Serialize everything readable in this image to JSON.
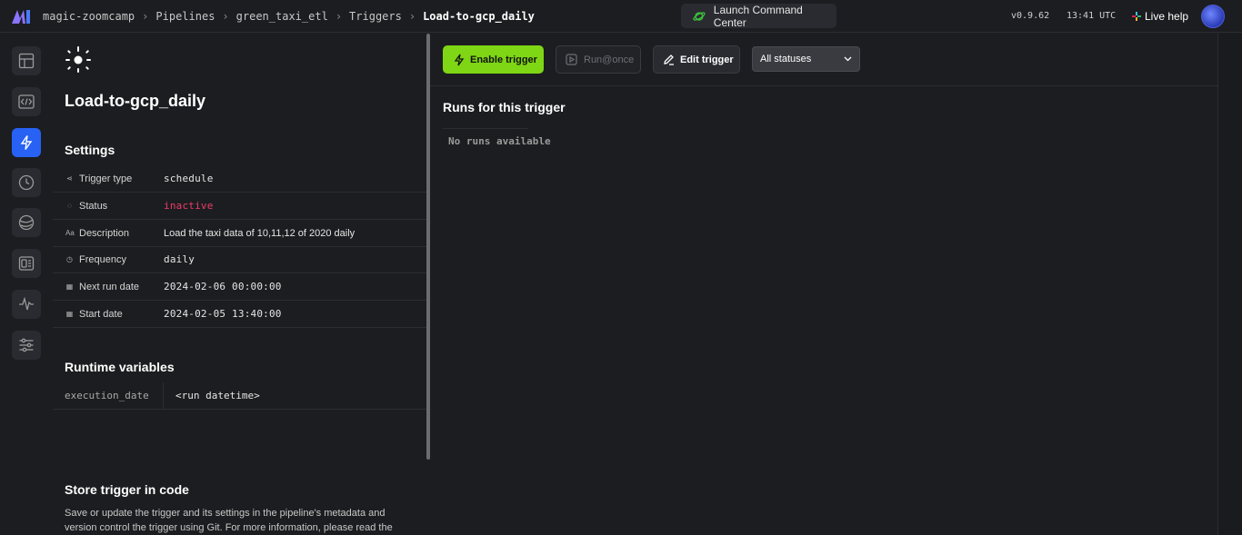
{
  "header": {
    "breadcrumbs": [
      "magic-zoomcamp",
      "Pipelines",
      "green_taxi_etl",
      "Triggers",
      "Load-to-gcp_daily"
    ],
    "command_center_label": "Launch Command Center",
    "version": "v0.9.62",
    "time": "13:41 UTC",
    "help_label": "Live help"
  },
  "nav": {
    "items": [
      "layout-icon",
      "code-icon",
      "lightning-icon",
      "clock-icon",
      "globe-icon",
      "terminal-icon",
      "activity-icon",
      "settings-sliders-icon"
    ],
    "active_index": 2
  },
  "trigger": {
    "title": "Load-to-gcp_daily",
    "settings_heading": "Settings",
    "settings": [
      {
        "icon": "⋖",
        "label": "Trigger type",
        "value": "schedule",
        "mono": true,
        "status": false
      },
      {
        "icon": "◌",
        "label": "Status",
        "value": "inactive",
        "mono": true,
        "status": true
      },
      {
        "icon": "Aa",
        "label": "Description",
        "value": "Load the taxi data of 10,11,12 of 2020 daily",
        "mono": false,
        "status": false
      },
      {
        "icon": "◷",
        "label": "Frequency",
        "value": "daily",
        "mono": true,
        "status": false
      },
      {
        "icon": "▦",
        "label": "Next run date",
        "value": "2024-02-06 00:00:00",
        "mono": true,
        "status": false
      },
      {
        "icon": "▦",
        "label": "Start date",
        "value": "2024-02-05 13:40:00",
        "mono": true,
        "status": false
      }
    ],
    "runtime_heading": "Runtime variables",
    "runtime_vars": [
      {
        "key": "execution_date",
        "value": "<run datetime>"
      }
    ],
    "store_heading": "Store trigger in code",
    "store_text": "Save or update the trigger and its settings in the pipeline's metadata and version control the trigger using Git. For more information, please read the"
  },
  "toolbar": {
    "enable_label": "Enable trigger",
    "run_once_label": "Run@once",
    "edit_label": "Edit trigger",
    "status_filter": "All statuses"
  },
  "runs": {
    "title": "Runs for this trigger",
    "empty_text": "No runs available"
  },
  "colors": {
    "accent_green": "#7ed614",
    "active_blue": "#2762f5",
    "inactive_red": "#ee3b6a"
  }
}
